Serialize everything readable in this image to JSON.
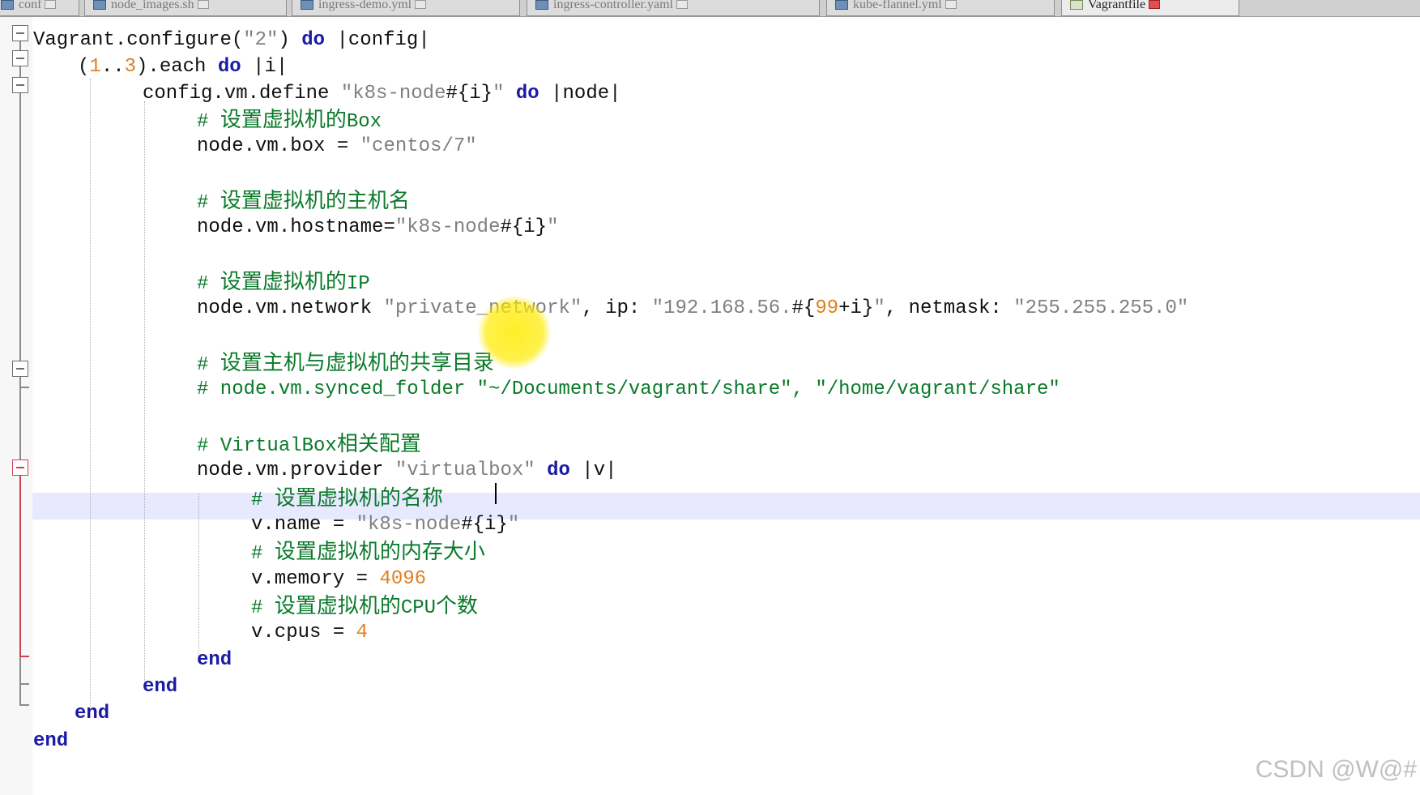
{
  "tabs": [
    {
      "label": "conf",
      "active": false
    },
    {
      "label": "node_images.sh",
      "active": false
    },
    {
      "label": "ingress-demo.yml",
      "active": false
    },
    {
      "label": "ingress-controller.yaml",
      "active": false
    },
    {
      "label": "kube-flannel.yml",
      "active": false
    },
    {
      "label": "Vagrantfile",
      "active": true
    }
  ],
  "code": {
    "l1_a": "Vagrant.configure(",
    "l1_str": "\"2\"",
    "l1_b": ") ",
    "l1_kw": "do",
    "l1_c": " |config|",
    "l2_a": "(",
    "l2_n1": "1",
    "l2_b": "..",
    "l2_n2": "3",
    "l2_c": ").each ",
    "l2_kw": "do",
    "l2_d": " |i|",
    "l3_a": "config.vm.define ",
    "l3_str": "\"k8s-node",
    "l3_interp": "#{i}",
    "l3_str2": "\"",
    "l3_b": " ",
    "l3_kw": "do",
    "l3_c": " |node|",
    "l4_hash": "# ",
    "l4_cjk": "设置虚拟机的",
    "l4_rest": "Box",
    "l5_a": "node.vm.box = ",
    "l5_str": "\"centos/7\"",
    "l7_hash": "# ",
    "l7_cjk": "设置虚拟机的主机名",
    "l8_a": "node.vm.hostname=",
    "l8_str": "\"k8s-node",
    "l8_interp": "#{i}",
    "l8_str2": "\"",
    "l10_hash": "# ",
    "l10_cjk": "设置虚拟机的",
    "l10_rest": "IP",
    "l11_a": "node.vm.network ",
    "l11_str": "\"private_network\"",
    "l11_b": ", ip: ",
    "l11_str2": "\"192.168.56.",
    "l11_interp1": "#{",
    "l11_num": "99",
    "l11_interp2": "+i}",
    "l11_str3": "\"",
    "l11_c": ", netmask: ",
    "l11_str4": "\"255.255.255.0\"",
    "l13_hash": "# ",
    "l13_cjk": "设置主机与虚拟机的共享目录",
    "l14": "# node.vm.synced_folder \"~/Documents/vagrant/share\", \"/home/vagrant/share\"",
    "l16_hash": "# ",
    "l16_rest": "VirtualBox",
    "l16_cjk": "相关配置",
    "l17_a": "node.vm.provider ",
    "l17_str": "\"virtualbox\"",
    "l17_b": " ",
    "l17_kw": "do",
    "l17_c": " |v|",
    "l18_hash": "# ",
    "l18_cjk": "设置虚拟机的名称",
    "l19_a": "v.name = ",
    "l19_str": "\"k8s-node",
    "l19_interp": "#{i}",
    "l19_str2": "\"",
    "l20_hash": "# ",
    "l20_cjk": "设置虚拟机的内存大小",
    "l21_a": "v.memory = ",
    "l21_num": "4096",
    "l22_hash": "# ",
    "l22_cjk1": "设置虚拟机的",
    "l22_rest": "CPU",
    "l22_cjk2": "个数",
    "l23_a": "v.cpus = ",
    "l23_num": "4",
    "end": "end"
  },
  "watermark": "CSDN @W@#",
  "colors": {
    "keyword": "#1a1aa6",
    "string": "#808080",
    "number": "#e08020",
    "comment": "#0a7a2a",
    "current_line": "#e8e8ff",
    "fold_marker_active": "#d04050"
  }
}
